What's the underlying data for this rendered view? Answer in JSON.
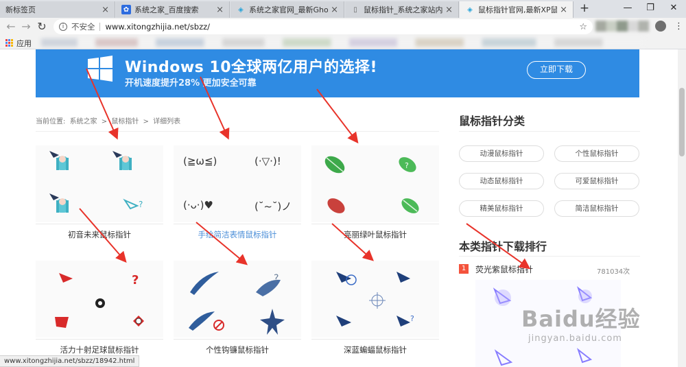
{
  "tabs": [
    {
      "title": "新标签页",
      "active": false
    },
    {
      "title": "系统之家_百度搜索",
      "active": false
    },
    {
      "title": "系统之家官网_最新Ghost XP S",
      "active": false
    },
    {
      "title": "鼠标指针_系统之家站内搜索",
      "active": false
    },
    {
      "title": "鼠标指针官网,最新XP鼠标指针",
      "active": true
    }
  ],
  "window_controls": {
    "minimize": "—",
    "restore": "❐",
    "close": "✕"
  },
  "toolbar": {
    "back": "←",
    "forward": "→",
    "reload": "↻",
    "security_label": "不安全",
    "url": "www.xitongzhijia.net/sbzz/",
    "star": "☆",
    "menu": "⋮"
  },
  "bookmarks": {
    "apps_label": "应用"
  },
  "banner": {
    "title": "Windows 10全球两亿用户的选择!",
    "subtitle": "开机速度提升28%  更加安全可靠",
    "button": "立即下载",
    "color": "#2f8be3"
  },
  "breadcrumb": {
    "prefix": "当前位置:",
    "items": [
      "系统之家",
      ">",
      "鼠标指针",
      ">",
      "详细列表"
    ]
  },
  "cards": [
    {
      "title": "初音未来鼠标指针",
      "link": false
    },
    {
      "title": "手绘简洁表情鼠标指针",
      "link": true
    },
    {
      "title": "亮丽绿叶鼠标指针",
      "link": false
    },
    {
      "title": "活力十射足球鼠标指针",
      "link": false
    },
    {
      "title": "个性钩镰鼠标指针",
      "link": false
    },
    {
      "title": "深蓝蝙蝠鼠标指针",
      "link": false
    }
  ],
  "kaomoji": [
    "(≧ω≦)",
    "(·▽·)!",
    "(·ᴗ·)♥",
    "(˘~˘)ノ"
  ],
  "sidebar": {
    "category_title": "鼠标指针分类",
    "categories": [
      "动漫鼠标指针",
      "个性鼠标指针",
      "动态鼠标指针",
      "可爱鼠标指针",
      "精美鼠标指针",
      "简洁鼠标指针"
    ],
    "ranking_title": "本类指针下载排行",
    "ranking": [
      {
        "rank": "1",
        "name": "荧光紫鼠标指针",
        "count": "781034次"
      }
    ]
  },
  "status_url": "www.xitongzhijia.net/sbzz/18942.html",
  "watermark": {
    "main": "Baidu经验",
    "sub": "jingyan.baidu.com"
  },
  "colors": {
    "accent_red": "#e8332a",
    "link": "#4a8ed8",
    "rank_badge": "#f4533c"
  }
}
